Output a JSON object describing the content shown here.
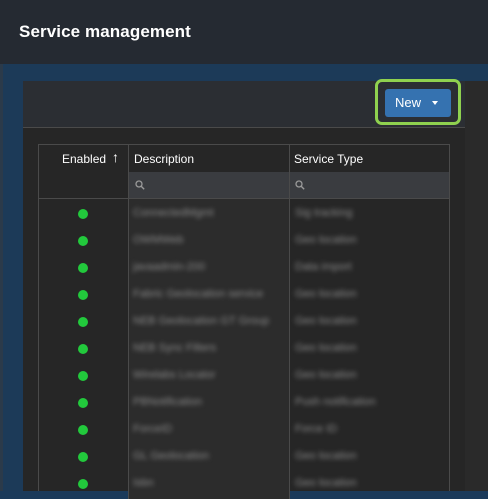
{
  "header": {
    "title": "Service management"
  },
  "toolbar": {
    "new_label": "New"
  },
  "grid": {
    "columns": [
      {
        "label": "Enabled",
        "sort": "ascending"
      },
      {
        "label": "Description"
      },
      {
        "label": "Service Type"
      }
    ],
    "rows": [
      {
        "enabled": true,
        "description": "ConnectedMgmt",
        "service_type": "Sig tracking"
      },
      {
        "enabled": true,
        "description": "OWMWeb",
        "service_type": "Geo location"
      },
      {
        "enabled": true,
        "description": "javaadmin-200",
        "service_type": "Data import"
      },
      {
        "enabled": true,
        "description": "Fabric Geolocation service",
        "service_type": "Geo location"
      },
      {
        "enabled": true,
        "description": "NEB Geolocation GT Group",
        "service_type": "Geo location"
      },
      {
        "enabled": true,
        "description": "NEB Sync Filters",
        "service_type": "Geo location"
      },
      {
        "enabled": true,
        "description": "Wirelabs Locator",
        "service_type": "Geo location"
      },
      {
        "enabled": true,
        "description": "PBNotification",
        "service_type": "Push notification"
      },
      {
        "enabled": true,
        "description": "ForceID",
        "service_type": "Force ID"
      },
      {
        "enabled": true,
        "description": "GL Geolocation",
        "service_type": "Geo location"
      },
      {
        "enabled": true,
        "description": "Isbn",
        "service_type": "Geo location"
      }
    ]
  },
  "colors": {
    "header_bg": "#252a32",
    "backdrop": "#1c3a58",
    "panel_bg": "#262626",
    "accent": "#3572b0",
    "highlight": "#8fd14f",
    "enabled_dot": "#22c93c"
  }
}
